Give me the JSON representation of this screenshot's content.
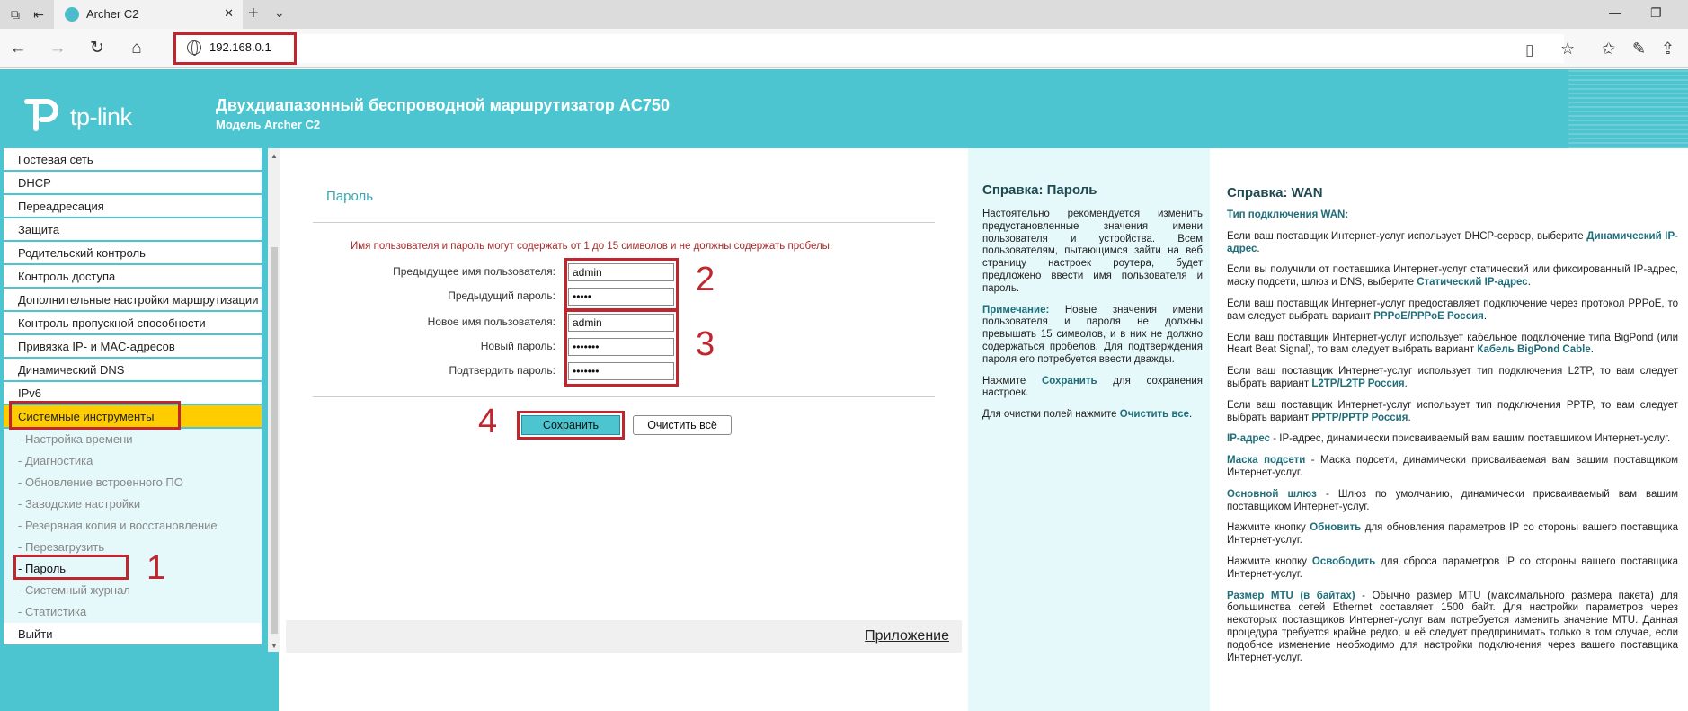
{
  "browser": {
    "tab_title": "Archer C2",
    "url": "192.168.0.1"
  },
  "header": {
    "logo": "tp-link",
    "title": "Двухдиапазонный беспроводной маршрутизатор AC750",
    "subtitle": "Модель Archer C2"
  },
  "menu": {
    "items": [
      "Гостевая сеть",
      "DHCP",
      "Переадресация",
      "Защита",
      "Родительский контроль",
      "Контроль доступа",
      "Дополнительные настройки маршрутизации",
      "Контроль пропускной способности",
      "Привязка IP- и MAC-адресов",
      "Динамический DNS",
      "IPv6",
      "Системные инструменты"
    ],
    "sub_items": [
      "- Настройка времени",
      "- Диагностика",
      "- Обновление встроенного ПО",
      "- Заводские настройки",
      "- Резервная копия и восстановление",
      "- Перезагрузить",
      "- Пароль",
      "- Системный журнал",
      "- Статистика"
    ],
    "logout": "Выйти"
  },
  "form": {
    "section_title": "Пароль",
    "warning": "Имя пользователя и пароль могут содержать от 1 до 15 символов и не должны содержать пробелы.",
    "old_user_label": "Предыдущее имя пользователя:",
    "old_user_value": "admin",
    "old_pass_label": "Предыдущий пароль:",
    "old_pass_value": "•••••",
    "new_user_label": "Новое имя пользователя:",
    "new_user_value": "admin",
    "new_pass_label": "Новый пароль:",
    "new_pass_value": "•••••••",
    "confirm_label": "Подтвердить пароль:",
    "confirm_value": "•••••••",
    "save": "Сохранить",
    "clear": "Очистить всё",
    "footer_link": "Приложение"
  },
  "annotations": [
    "1",
    "2",
    "3",
    "4"
  ],
  "help1": {
    "title": "Справка: Пароль",
    "p1": "Настоятельно рекомендуется изменить предустановленные значения имени пользователя и устройства. Всем пользователям, пытающимся зайти на веб страницу настроек роутера, будет предложено ввести имя пользователя и пароль.",
    "note_label": "Примечание:",
    "note_text": " Новые значения имени пользователя и пароля не должны превышать 15 символов, и в них не должно содержаться пробелов. Для подтверждения пароля его потребуется ввести дважды.",
    "save_pre": "Нажмите ",
    "save_word": "Сохранить",
    "save_post": " для сохранения настроек.",
    "clear_pre": "Для очистки полей нажмите ",
    "clear_word": "Очистить все",
    "clear_post": "."
  },
  "help2": {
    "title": "Справка: WAN",
    "type_label": "Тип подключения WAN:",
    "dhcp_pre": "Если ваш поставщик Интернет-услуг использует DHCP-сервер, выберите ",
    "dhcp_word": "Динамический IP-адрес",
    "dhcp_post": ".",
    "static_pre": "Если вы получили от поставщика Интернет-услуг статический или фиксированный IP-адрес, маску подсети, шлюз и DNS, выберите ",
    "static_word": "Статический IP-адрес",
    "static_post": ".",
    "pppoe_pre": "Если ваш поставщик Интернет-услуг предоставляет подключение через протокол PPPoE, то вам следует выбрать вариант ",
    "pppoe_word": "PPPoE/PPPoE Россия",
    "pppoe_post": ".",
    "bigpond_pre": "Если ваш поставщик Интернет-услуг использует кабельное подключение типа BigPond (или Heart Beat Signal), то вам следует выбрать вариант ",
    "bigpond_word": "Кабель BigPond Cable",
    "bigpond_post": ".",
    "l2tp_pre": "Если ваш поставщик Интернет-услуг использует тип подключения L2TP, то вам следует выбрать вариант ",
    "l2tp_word": "L2TP/L2TP Россия",
    "l2tp_post": ".",
    "pptp_pre": "Если ваш поставщик Интернет-услуг использует тип подключения PPTP, то вам следует выбрать вариант ",
    "pptp_word": "PPTP/PPTP Россия",
    "pptp_post": ".",
    "ip_word": "IP-адрес",
    "ip_text": " - IP-адрес, динамически присваиваемый вам вашим поставщиком Интернет-услуг.",
    "mask_word": "Маска подсети",
    "mask_text": " - Маска подсети, динамически присваиваемая вам вашим поставщиком Интернет-услуг.",
    "gw_word": "Основной шлюз",
    "gw_text": " - Шлюз по умолчанию, динамически присваиваемый вам вашим поставщиком Интернет-услуг.",
    "renew_pre": "Нажмите кнопку ",
    "renew_word": "Обновить",
    "renew_post": " для обновления параметров IP со стороны вашего поставщика Интернет-услуг.",
    "release_pre": "Нажмите кнопку ",
    "release_word": "Освободить",
    "release_post": " для сброса параметров IP со стороны вашего поставщика Интернет-услуг.",
    "mtu_word": "Размер MTU (в байтах)",
    "mtu_text": " - Обычно размер MTU (максимального размера пакета) для большинства сетей Ethernet составляет 1500 байт. Для настройки параметров через некоторых поставщиков Интернет-услуг вам потребуется изменить значение MTU. Данная процедура требуется крайне редко, и её следует предпринимать только в том случае, если подобное изменение необходимо для настройки подключения через вашего поставщика Интернет-услуг."
  }
}
